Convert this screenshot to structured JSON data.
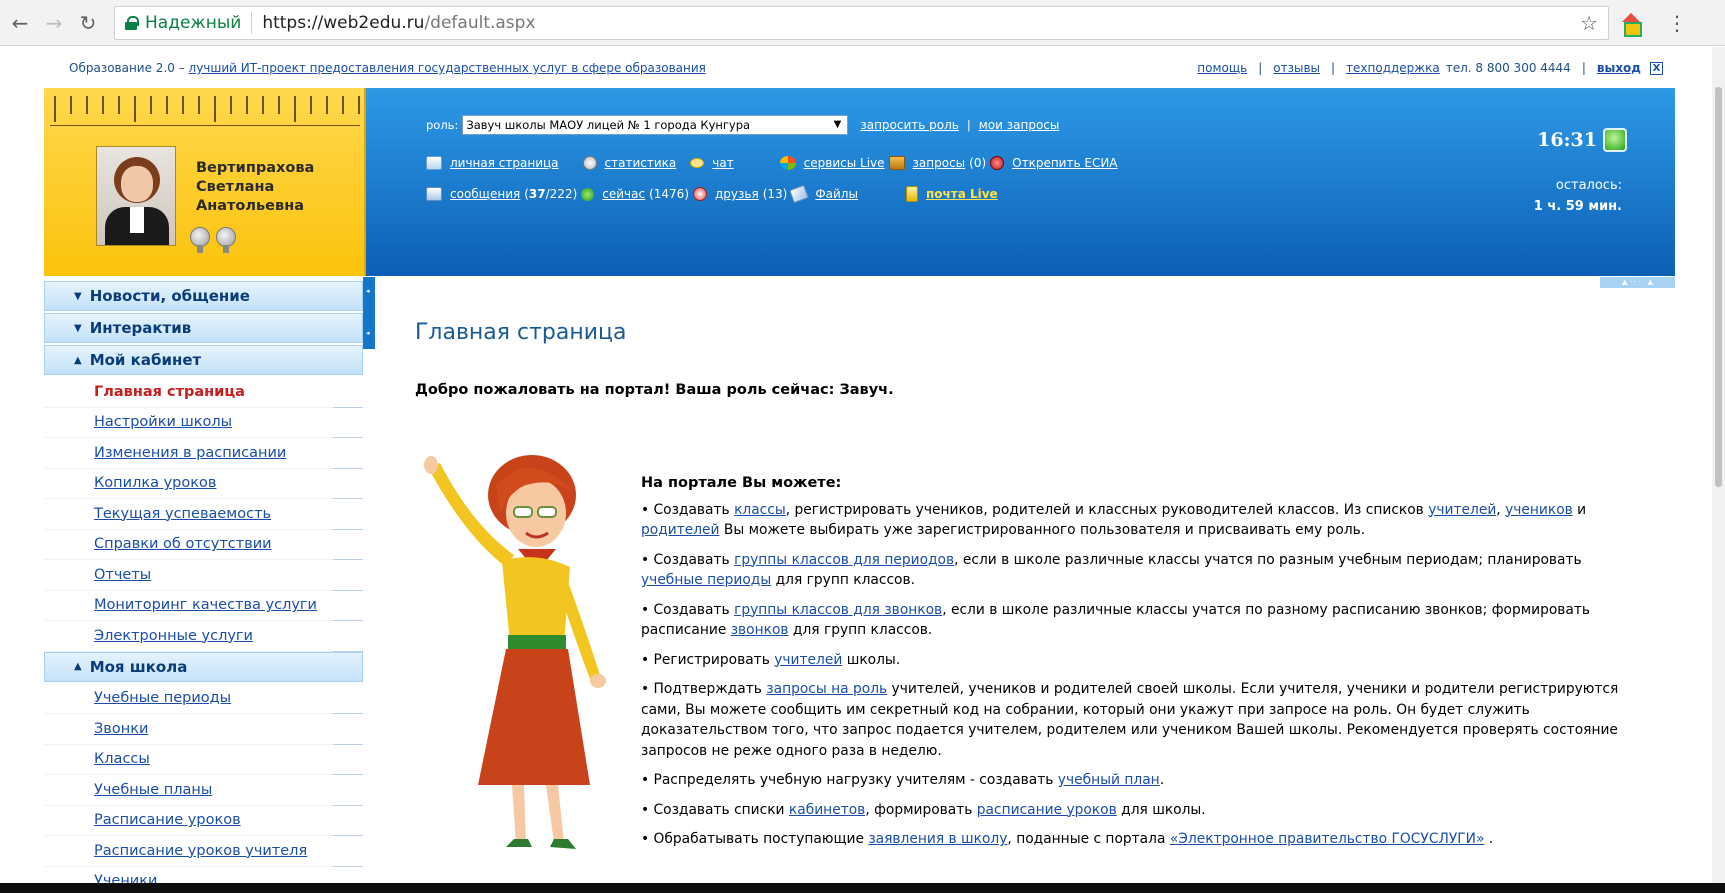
{
  "browser": {
    "secure_label": "Надежный",
    "url_host": "https://web2edu.ru",
    "url_path": "/default.aspx"
  },
  "topstrip": {
    "tagline_prefix": "Образование 2.0 – ",
    "tagline_link": "лучший ИТ-проект предоставления государственных услуг в сфере образования",
    "help": "помощь",
    "sep": "|",
    "reviews": "отзывы",
    "support": "техподдержка",
    "phone": "тел. 8 800 300 4444",
    "logout": "выход",
    "logout_icon": "X"
  },
  "profile": {
    "name_line1": "Вертипрахова",
    "name_line2": "Светлана",
    "name_line3": "Анатольевна"
  },
  "header": {
    "role_label": "роль:",
    "role_value": "Завуч школы МАОУ лицей № 1 города Кунгура",
    "request_role": "запросить роль",
    "sep": "|",
    "my_requests": "мои запросы",
    "personal_page": "личная страница",
    "statistics": "статистика",
    "chat": "чат",
    "services_live": "сервисы Live",
    "requests": "запросы",
    "requests_count": "(0)",
    "unlink_esia": "Открепить ЕСИА",
    "messages": "сообщения",
    "messages_count_prefix": "(",
    "messages_new": "37",
    "messages_total": "/222)",
    "now": "сейчас",
    "now_count": "(1476)",
    "friends": "друзья",
    "friends_count": "(13)",
    "files": "Файлы",
    "mail_live": "почта Live",
    "time": "16:31",
    "remaining_label": "осталось:",
    "remaining_value": "1 ч. 59 мин."
  },
  "sidebar": {
    "sections": [
      {
        "label": "Новости, общение",
        "arrow": "▼"
      },
      {
        "label": "Интерактив",
        "arrow": "▼"
      },
      {
        "label": "Мой кабинет",
        "arrow": "▲"
      },
      {
        "label": "Моя школа",
        "arrow": "▲"
      }
    ],
    "cabinet_items": [
      "Главная страница",
      "Настройки школы",
      "Изменения в расписании",
      "Копилка уроков",
      "Текущая успеваемость",
      "Справки об отсутствии",
      "Отчеты",
      "Мониторинг качества услуги",
      "Электронные услуги"
    ],
    "school_items": [
      "Учебные периоды",
      "Звонки",
      "Классы",
      "Учебные планы",
      "Расписание уроков",
      "Расписание уроков учителя",
      "Ученики"
    ]
  },
  "main": {
    "title": "Главная страница",
    "welcome": "Добро пожаловать на портал! Ваша роль сейчас: Завуч.",
    "heading": "На портале Вы можете:",
    "b1": {
      "t1": "• Создавать ",
      "l1": "классы",
      "t2": ", регистрировать учеников, родителей и классных руководителей классов. Из списков ",
      "l2": "учителей",
      "t3": ", ",
      "l3": "учеников",
      "t4": " и ",
      "l4": "родителей",
      "t5": " Вы можете выбирать уже зарегистрированного пользователя и присваивать ему роль."
    },
    "b2": {
      "t1": "• Создавать ",
      "l1": "группы классов для периодов",
      "t2": ", если в школе различные классы учатся по разным учебным периодам; планировать ",
      "l2": "учебные периоды",
      "t3": " для групп классов."
    },
    "b3": {
      "t1": "• Создавать ",
      "l1": "группы классов для звонков",
      "t2": ", если в школе различные классы учатся по разному расписанию звонков; формировать расписание ",
      "l2": "звонков",
      "t3": " для групп классов."
    },
    "b4": {
      "t1": "• Регистрировать ",
      "l1": "учителей",
      "t2": " школы."
    },
    "b5": {
      "t1": "• Подтверждать ",
      "l1": "запросы на роль",
      "t2": " учителей, учеников и родителей своей школы. Если учителя, ученики и родители регистрируются сами, Вы можете сообщить им секретный код на собрании, который они укажут при запросе на роль. Он будет служить доказательством того, что запрос подается учителем, родителем или учеником Вашей школы. Рекомендуется проверять состояние запросов не реже одного раза в неделю."
    },
    "b6": {
      "t1": "• Распределять учебную нагрузку учителям - создавать ",
      "l1": "учебный план",
      "t2": "."
    },
    "b7": {
      "t1": "• Создавать списки ",
      "l1": "кабинетов",
      "t2": ", формировать ",
      "l2": "расписание уроков",
      "t3": " для школы."
    },
    "b8": {
      "t1": "• Обрабатывать поступающие ",
      "l1": "заявления в школу",
      "t2": ", поданные с портала ",
      "l2": "«Электронное правительство ГОСУСЛУГИ»",
      "t3": " ."
    }
  }
}
